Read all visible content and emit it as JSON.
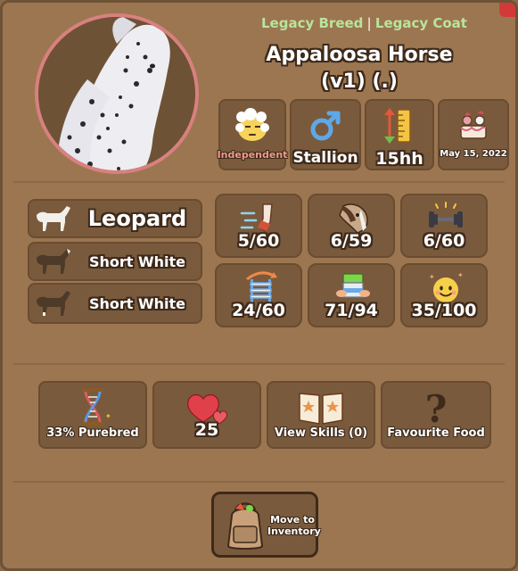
{
  "header": {
    "legacy_breed": "Legacy Breed",
    "separator": "|",
    "legacy_coat": "Legacy Coat",
    "horse_name": "Appaloosa Horse",
    "horse_version": "(v1) (.)"
  },
  "info_tiles": [
    {
      "label": "Independent",
      "icon": "cloud-face-icon"
    },
    {
      "label": "Stallion",
      "icon": "male-symbol-icon"
    },
    {
      "label": "15hh",
      "icon": "height-ruler-icon"
    },
    {
      "label": "May 15, 2022",
      "icon": "birthday-cake-icon"
    }
  ],
  "genes": [
    {
      "label": "Leopard"
    },
    {
      "label": "Short White"
    },
    {
      "label": "Short White"
    }
  ],
  "stats": [
    {
      "value": "5/60",
      "icon": "speed-icon"
    },
    {
      "value": "6/59",
      "icon": "horse-head-icon"
    },
    {
      "value": "6/60",
      "icon": "dumbbell-icon"
    },
    {
      "value": "24/60",
      "icon": "jump-ladder-icon"
    },
    {
      "value": "71/94",
      "icon": "food-bowl-icon"
    },
    {
      "value": "35/100",
      "icon": "happy-face-icon"
    }
  ],
  "bottom": [
    {
      "label": "33% Purebred",
      "icon": "dna-hourglass-icon"
    },
    {
      "label": "25",
      "icon": "hearts-icon"
    },
    {
      "label": "View Skills (0)",
      "icon": "skill-book-icon"
    },
    {
      "label": "Favourite Food",
      "icon": "question-mark-icon"
    }
  ],
  "inventory_button": {
    "label": "Move to Inventory",
    "icon": "backpack-icon"
  },
  "colors": {
    "panel": "#9c7650",
    "tile": "#7a5a3c",
    "legacy_text": "#b9e49c",
    "independent_text": "#f09a8a",
    "portrait_ring": "#d98080"
  }
}
